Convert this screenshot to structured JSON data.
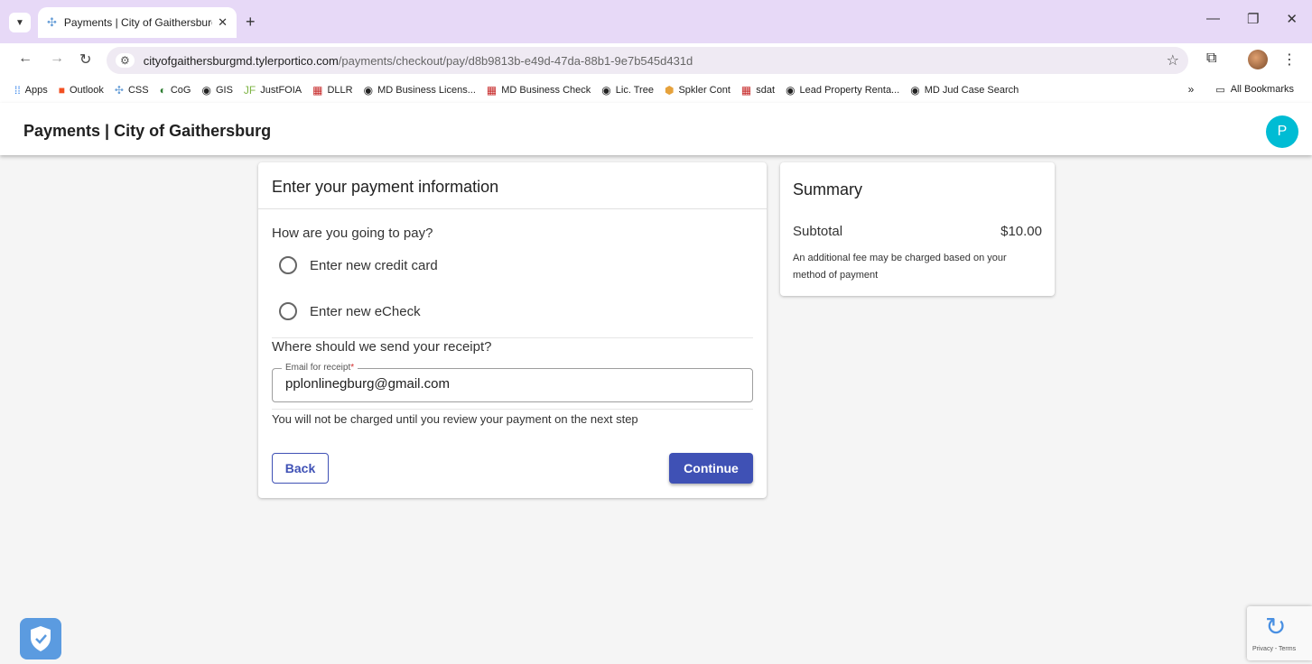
{
  "browser": {
    "tab_title": "Payments | City of Gaithersburg",
    "url_host": "cityofgaithersburgmd.tylerportico.com",
    "url_path": "/payments/checkout/pay/d8b9813b-e49d-47da-88b1-9e7b545d431d",
    "bookmarks": [
      "Apps",
      "Outlook",
      "CSS",
      "CoG",
      "GIS",
      "JustFOIA",
      "DLLR",
      "MD Business Licens...",
      "MD Business Check",
      "Lic. Tree",
      "Spkler Cont",
      "sdat",
      "Lead Property Renta...",
      "MD Jud Case Search"
    ],
    "all_bookmarks": "All Bookmarks"
  },
  "header": {
    "title": "Payments | City of Gaithersburg",
    "avatar_initial": "P",
    "avatar_color": "#00bcd4"
  },
  "payment": {
    "title": "Enter your payment information",
    "question": "How are you going to pay?",
    "option_card": "Enter new credit card",
    "option_echeck": "Enter new eCheck",
    "receipt_question": "Where should we send your receipt?",
    "email_label": "Email for receipt",
    "email_required_mark": "*",
    "email_value": "pplonlinegburg@gmail.com",
    "notice": "You will not be charged until you review your payment on the next step",
    "back_label": "Back",
    "continue_label": "Continue",
    "accent_color": "#3f51b5"
  },
  "summary": {
    "title": "Summary",
    "subtotal_label": "Subtotal",
    "subtotal_value": "$10.00",
    "fee_note": "An additional fee may be charged based on your method of payment"
  },
  "recaptcha": {
    "text": "Privacy - Terms"
  }
}
